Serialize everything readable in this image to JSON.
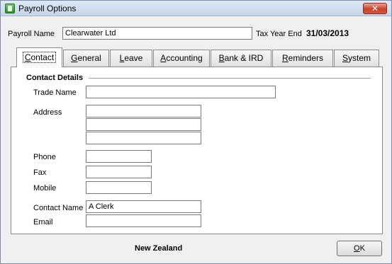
{
  "window": {
    "title": "Payroll Options",
    "close_glyph": "✕"
  },
  "header": {
    "payroll_name_label": "Payroll Name",
    "payroll_name_value": "Clearwater Ltd",
    "tax_year_end_label": "Tax Year End",
    "tax_year_end_value": "31/03/2013"
  },
  "tabs": [
    {
      "label": "Contact",
      "mnemonic": "C",
      "rest": "ontact",
      "active": true
    },
    {
      "label": "General",
      "mnemonic": "G",
      "rest": "eneral"
    },
    {
      "label": "Leave",
      "mnemonic": "L",
      "rest": "eave"
    },
    {
      "label": "Accounting",
      "mnemonic": "A",
      "rest": "ccounting"
    },
    {
      "label": "Bank & IRD",
      "mnemonic": "B",
      "rest": "ank & IRD"
    },
    {
      "label": "Reminders",
      "mnemonic": "R",
      "rest": "eminders"
    },
    {
      "label": "System",
      "mnemonic": "S",
      "rest": "ystem"
    }
  ],
  "contact": {
    "section_title": "Contact Details",
    "trade_name_label": "Trade Name",
    "trade_name_value": "",
    "address_label": "Address",
    "address_lines": [
      "",
      "",
      ""
    ],
    "phone_label": "Phone",
    "phone_value": "",
    "fax_label": "Fax",
    "fax_value": "",
    "mobile_label": "Mobile",
    "mobile_value": "",
    "contact_name_label": "Contact Name",
    "contact_name_value": "A Clerk",
    "email_label": "Email",
    "email_value": ""
  },
  "footer": {
    "country": "New Zealand",
    "ok_mnemonic": "O",
    "ok_rest": "K"
  },
  "colors": {
    "close_button": "#c7432b",
    "title_bar": "#c5d6ea",
    "app_icon": "#2f8d2a"
  }
}
